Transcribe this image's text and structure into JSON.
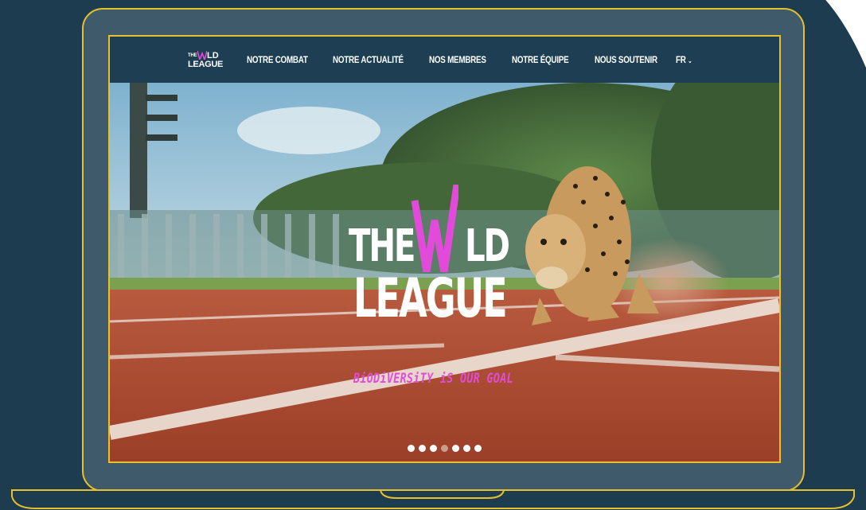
{
  "nav": {
    "logo": {
      "the": "THE",
      "w": "W",
      "ld": "LD",
      "league": "LEAGUE"
    },
    "items": [
      {
        "label": "NOTRE COMBAT"
      },
      {
        "label": "NOTRE ACTUALITÉ"
      },
      {
        "label": "NOS MEMBRES"
      },
      {
        "label": "NOTRE ÉQUIPE"
      },
      {
        "label": "NOUS SOUTENIR"
      }
    ],
    "language": {
      "label": "FR",
      "icon": "chevron-down-icon"
    }
  },
  "hero": {
    "logo": {
      "the": "THE",
      "w": "W",
      "ld": "LD",
      "league": "LEAGUE"
    },
    "tagline": "BiODiVERSiTY iS OUR GOAL",
    "image_subject": "cheetah running on athletics track",
    "slides_total": 7,
    "slide_active": 4
  },
  "colors": {
    "background": "#1d3c4f",
    "laptop_outline": "#e8c12a",
    "navbar": "#1e3f53",
    "accent_pink": "#e24bd9",
    "track_red": "#b4533b"
  }
}
